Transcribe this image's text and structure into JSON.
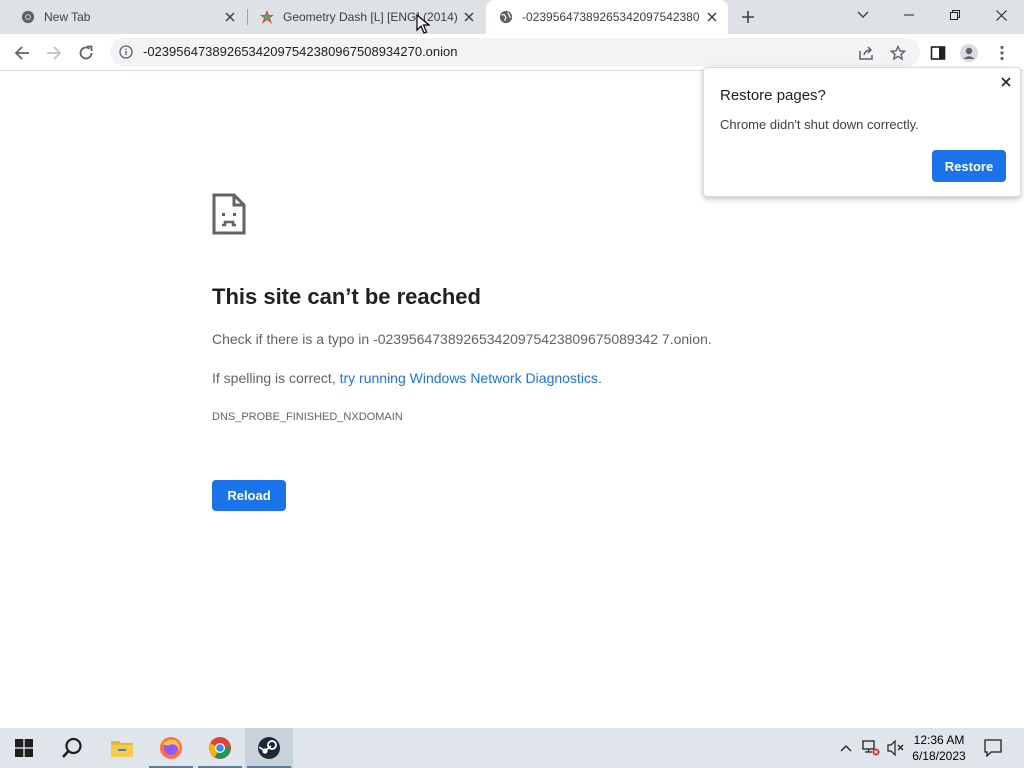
{
  "tabs": [
    {
      "title": "New Tab",
      "favicon": "chrome-icon",
      "active": false
    },
    {
      "title": "Geometry Dash [L] [ENG] (2014)",
      "favicon": "geometry-dash-icon",
      "active": false
    },
    {
      "title": "-02395647389265342097542380",
      "favicon": "globe-icon",
      "active": true
    }
  ],
  "toolbar": {
    "url": "-02395647389265342097542380967508934270.onion"
  },
  "error": {
    "title": "This site can’t be reached",
    "line1": "Check if there is a typo in -023956473892653420975423809675089342 7.onion.",
    "line2_prefix": "If spelling is correct, ",
    "line2_link": "try running Windows Network Diagnostics",
    "line2_suffix": ".",
    "code": "DNS_PROBE_FINISHED_NXDOMAIN",
    "reload_label": "Reload"
  },
  "restore_bubble": {
    "title": "Restore pages?",
    "message": "Chrome didn't shut down correctly.",
    "button_label": "Restore"
  },
  "taskbar": {
    "apps": [
      "start-icon",
      "search-icon",
      "file-explorer-icon",
      "firefox-icon",
      "chrome-icon",
      "steam-icon"
    ],
    "time": "12:36 AM",
    "date": "6/18/2023"
  },
  "colors": {
    "accent": "#1a73e8",
    "tabstrip": "#dee1e6",
    "taskbar": "#dfe5ea"
  }
}
